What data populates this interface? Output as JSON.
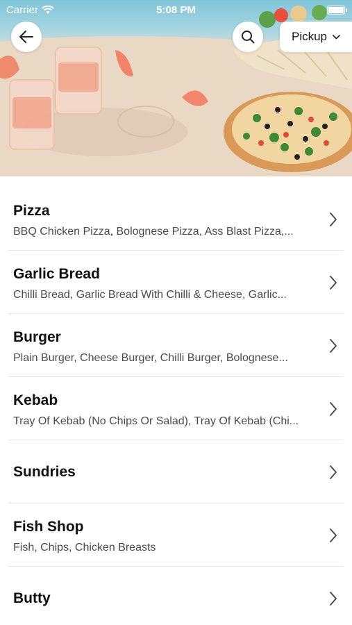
{
  "status_bar": {
    "carrier": "Carrier",
    "time": "5:08 PM"
  },
  "header": {
    "back_icon": "arrow-left-icon",
    "search_icon": "search-icon",
    "pickup_label": "Pickup",
    "pickup_icon": "chevron-down-icon"
  },
  "categories": [
    {
      "title": "Pizza",
      "subtitle": "BBQ Chicken Pizza, Bolognese Pizza, Ass Blast Pizza,..."
    },
    {
      "title": "Garlic Bread",
      "subtitle": "Chilli Bread, Garlic Bread With Chilli & Cheese, Garlic..."
    },
    {
      "title": "Burger",
      "subtitle": "Plain Burger, Cheese Burger, Chilli Burger, Bolognese..."
    },
    {
      "title": "Kebab",
      "subtitle": "Tray Of Kebab (No Chips Or Salad), Tray Of Kebab (Chi..."
    },
    {
      "title": "Sundries",
      "subtitle": ""
    },
    {
      "title": "Fish Shop",
      "subtitle": "Fish, Chips, Chicken Breasts"
    },
    {
      "title": "Butty",
      "subtitle": ""
    }
  ]
}
